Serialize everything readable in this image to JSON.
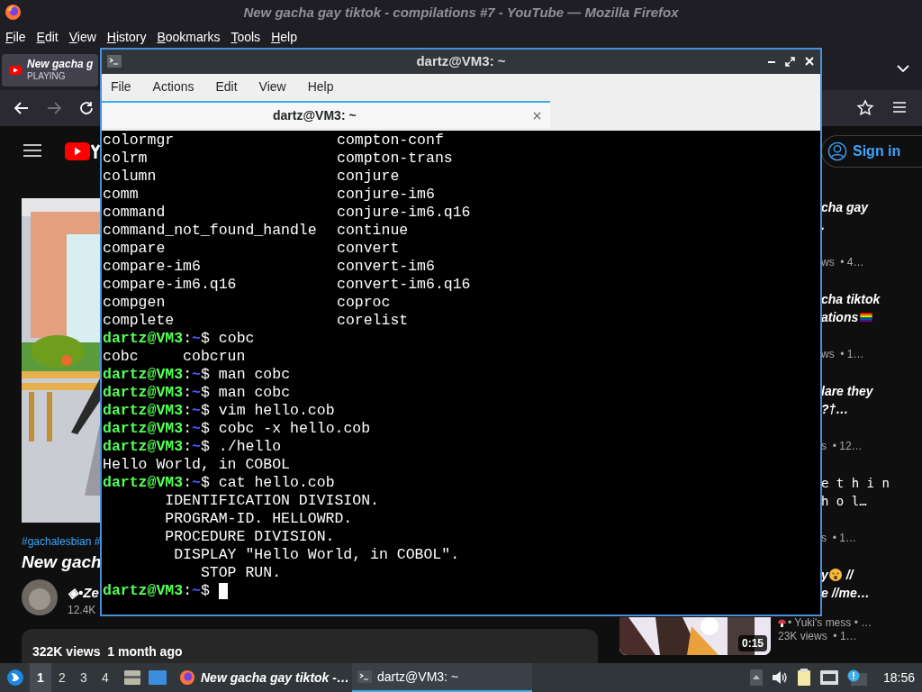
{
  "firefox": {
    "title": "New gacha gay tiktok - compilations #7 - YouTube — Mozilla Firefox",
    "menu": [
      "File",
      "Edit",
      "View",
      "History",
      "Bookmarks",
      "Tools",
      "Help"
    ],
    "tab": {
      "title": "New gacha g",
      "status": "PLAYING"
    }
  },
  "youtube": {
    "sign_in": "Sign in",
    "hashtags": "#gachalesbian #",
    "video_title": "New gach",
    "channel": "◈•Ze",
    "subscribers": "12.4K",
    "views": "322K views  1 month ago",
    "sidebar": [
      {
        "titles": [
          "cha gay",
          "."
        ],
        "meta": "ws  • 4…"
      },
      {
        "titles": [
          "cha tiktok",
          "ations"
        ],
        "flag": true,
        "meta": "ws  • 1…"
      },
      {
        "titles": [
          "lare they",
          "?†…"
        ],
        "meta": "s  • 12…"
      },
      {
        "titles": [
          "e t h i n",
          "h o l…"
        ],
        "meta": "s  • 1…"
      },
      {
        "titles": [
          "y",
          "e //me…"
        ],
        "face": true,
        "suffix": " //"
      }
    ],
    "last": {
      "channel": "• Yuki's mess • …",
      "meta": "23K views  • 1…",
      "duration": "0:15"
    }
  },
  "terminal": {
    "title": "dartz@VM3: ~",
    "prompt_separator": ":",
    "prompt_sign": "$",
    "menu": [
      "File",
      "Actions",
      "Edit",
      "View",
      "Help"
    ],
    "tab": "dartz@VM3: ~",
    "lines": [
      {
        "kind": "columns",
        "cells": [
          "colormgr",
          "compton-conf"
        ]
      },
      {
        "kind": "columns",
        "cells": [
          "colrm",
          "compton-trans"
        ]
      },
      {
        "kind": "columns",
        "cells": [
          "column",
          "conjure"
        ]
      },
      {
        "kind": "columns",
        "cells": [
          "comm",
          "conjure-im6"
        ]
      },
      {
        "kind": "columns",
        "cells": [
          "command",
          "conjure-im6.q16"
        ]
      },
      {
        "kind": "columns",
        "cells": [
          "command_not_found_handle",
          "continue"
        ]
      },
      {
        "kind": "columns",
        "cells": [
          "compare",
          "convert"
        ]
      },
      {
        "kind": "columns",
        "cells": [
          "compare-im6",
          "convert-im6"
        ]
      },
      {
        "kind": "columns",
        "cells": [
          "compare-im6.q16",
          "convert-im6.q16"
        ]
      },
      {
        "kind": "columns",
        "cells": [
          "compgen",
          "coproc"
        ]
      },
      {
        "kind": "columns",
        "cells": [
          "complete",
          "corelist"
        ]
      },
      {
        "kind": "prompt",
        "user": "dartz@VM3",
        "path": "~",
        "command": "cobc"
      },
      {
        "kind": "output",
        "text": "cobc     cobcrun"
      },
      {
        "kind": "prompt",
        "user": "dartz@VM3",
        "path": "~",
        "command": "man cobc"
      },
      {
        "kind": "prompt",
        "user": "dartz@VM3",
        "path": "~",
        "command": "man cobc"
      },
      {
        "kind": "prompt",
        "user": "dartz@VM3",
        "path": "~",
        "command": "vim hello.cob"
      },
      {
        "kind": "prompt",
        "user": "dartz@VM3",
        "path": "~",
        "command": "cobc -x hello.cob"
      },
      {
        "kind": "prompt",
        "user": "dartz@VM3",
        "path": "~",
        "command": "./hello"
      },
      {
        "kind": "output",
        "text": "Hello World, in COBOL"
      },
      {
        "kind": "prompt",
        "user": "dartz@VM3",
        "path": "~",
        "command": "cat hello.cob"
      },
      {
        "kind": "output",
        "text": "       IDENTIFICATION DIVISION."
      },
      {
        "kind": "output",
        "text": "       PROGRAM-ID. HELLOWRD."
      },
      {
        "kind": "output",
        "text": "       PROCEDURE DIVISION."
      },
      {
        "kind": "output",
        "text": "        DISPLAY \"Hello World, in COBOL\"."
      },
      {
        "kind": "output",
        "text": "           STOP RUN."
      },
      {
        "kind": "prompt",
        "user": "dartz@VM3",
        "path": "~",
        "cursor": true
      }
    ]
  },
  "taskbar": {
    "workspaces": [
      {
        "label": "1",
        "selected": true
      },
      {
        "label": "2",
        "selected": false
      },
      {
        "label": "3",
        "selected": false
      },
      {
        "label": "4",
        "selected": false
      }
    ],
    "tasks": [
      {
        "kind": "firefox",
        "label": "New gacha gay tiktok -…",
        "selected": false
      },
      {
        "kind": "terminal",
        "label": "dartz@VM3: ~",
        "selected": true
      }
    ],
    "clock": "18:56"
  }
}
